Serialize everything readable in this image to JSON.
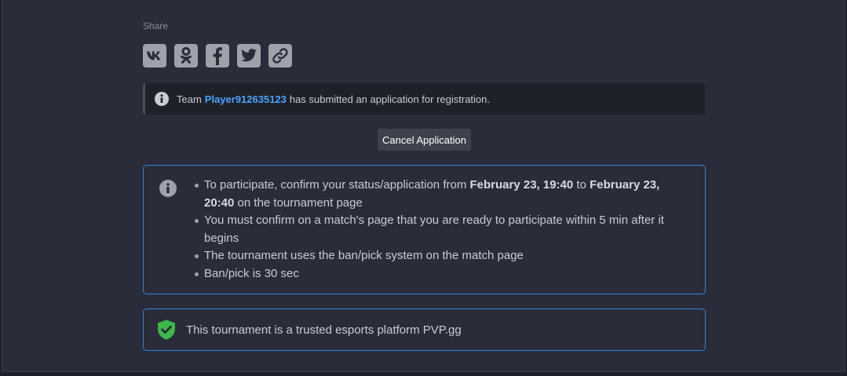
{
  "share": {
    "title": "Share",
    "buttons": [
      {
        "name": "vk",
        "icon": "vk-icon"
      },
      {
        "name": "odnoklassniki",
        "icon": "odnoklassniki-icon"
      },
      {
        "name": "facebook",
        "icon": "facebook-icon"
      },
      {
        "name": "twitter",
        "icon": "twitter-icon"
      },
      {
        "name": "link",
        "icon": "link-icon"
      }
    ]
  },
  "notice": {
    "icon": "info-icon",
    "prefix": "Team",
    "team_name": "Player912635123",
    "suffix": "has submitted an application for registration."
  },
  "cancel_button": {
    "label": "Cancel Application"
  },
  "rules": {
    "icon": "info-icon",
    "items": [
      {
        "part1": "To participate, confirm your status/application from",
        "date_from": "February 23, 19:40",
        "mid": "to",
        "date_to": "February 23, 20:40",
        "part2": "on the tournament page"
      },
      {
        "text": "You must confirm on a match's page that you are ready to participate within 5 min after it begins"
      },
      {
        "text": "The tournament uses the ban/pick system on the match page"
      },
      {
        "text": "Ban/pick is 30 sec"
      }
    ]
  },
  "trusted": {
    "icon": "shield-check-icon",
    "text": "This tournament is a trusted esports platform PVP.gg"
  },
  "colors": {
    "accent": "#2f86d6",
    "link": "#4aa3ff",
    "shield": "#3cb84a",
    "background": "#2a2c3a"
  }
}
